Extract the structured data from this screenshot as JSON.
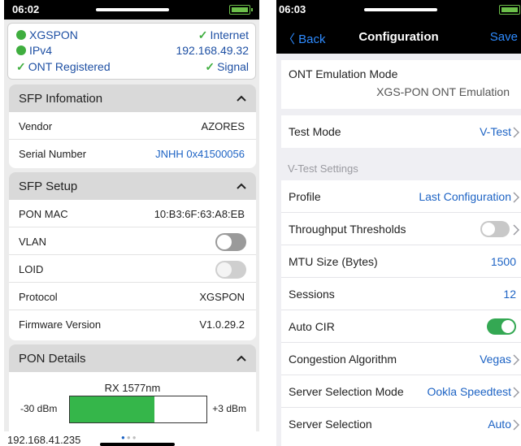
{
  "left_screen": {
    "status_bar": {
      "time": "06:02"
    },
    "status": {
      "items": [
        {
          "label": "XGSPON",
          "value": "Internet"
        },
        {
          "label": "IPv4",
          "value": "192.168.49.32"
        },
        {
          "label": "ONT Registered",
          "value": "Signal"
        }
      ]
    },
    "sfp_info": {
      "title": "SFP Infomation",
      "rows": [
        {
          "label": "Vendor",
          "value": "AZORES"
        },
        {
          "label": "Serial Number",
          "value": "JNHH 0x41500056"
        }
      ]
    },
    "sfp_setup": {
      "title": "SFP Setup",
      "rows": [
        {
          "label": "PON MAC",
          "value": "10:B3:6F:63:A8:EB"
        },
        {
          "label": "VLAN"
        },
        {
          "label": "LOID"
        },
        {
          "label": "Protocol",
          "value": "XGSPON"
        },
        {
          "label": "Firmware Version",
          "value": "V1.0.29.2"
        }
      ]
    },
    "pon_details": {
      "title": "PON Details",
      "gauge_title": "RX 1577nm",
      "min_label": "-30 dBm",
      "max_label": "+3 dBm",
      "level_fraction": 0.62
    },
    "bottom": {
      "ip": "192.168.41.235",
      "pages": 3,
      "active_page": 1
    }
  },
  "right_screen": {
    "status_bar": {
      "time": "06:03"
    },
    "nav": {
      "back": "Back",
      "title": "Configuration",
      "save": "Save"
    },
    "ont_mode": {
      "label": "ONT Emulation Mode",
      "value": "XGS-PON ONT Emulation"
    },
    "test_mode": {
      "label": "Test Mode",
      "value": "V-Test"
    },
    "vtest_section": "V-Test Settings",
    "settings": {
      "profile": {
        "label": "Profile",
        "value": "Last Configuration"
      },
      "throughput": {
        "label": "Throughput Thresholds"
      },
      "mtu": {
        "label": "MTU Size (Bytes)",
        "value": "1500"
      },
      "sessions": {
        "label": "Sessions",
        "value": "12"
      },
      "auto_cir": {
        "label": "Auto CIR"
      },
      "congestion": {
        "label": "Congestion Algorithm",
        "value": "Vegas"
      },
      "server_mode": {
        "label": "Server Selection Mode",
        "value": "Ookla Speedtest"
      },
      "server": {
        "label": "Server Selection",
        "value": "Auto"
      }
    }
  },
  "colors": {
    "accent_blue": "#1d63c4",
    "ios_blue": "#2e8bff",
    "green": "#35b64a",
    "section_header": "#d9d9d9"
  }
}
